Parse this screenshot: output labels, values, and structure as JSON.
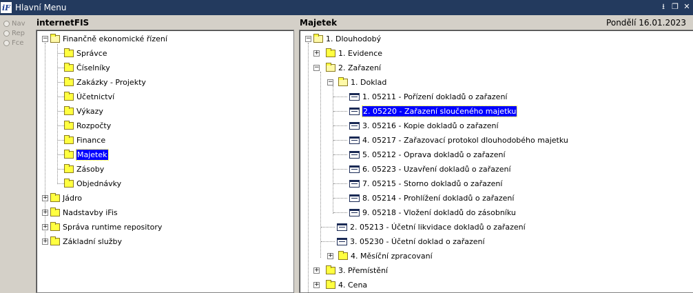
{
  "window": {
    "title": "Hlavní Menu"
  },
  "side_radios": [
    "Nav",
    "Rep",
    "Fce"
  ],
  "left_panel": {
    "header": "internetFIS",
    "root": "Finančně ekonomické řízení",
    "children": [
      "Správce",
      "Číselníky",
      "Zakázky - Projekty",
      "Účetnictví",
      "Výkazy",
      "Rozpočty",
      "Finance",
      "Majetek",
      "Zásoby",
      "Objednávky"
    ],
    "selected": "Majetek",
    "others": [
      "Jádro",
      "Nadstavby iFis",
      "Správa runtime repository",
      "Základní služby"
    ]
  },
  "right_panel": {
    "header": "Majetek",
    "date": "Pondělí 16.01.2023",
    "root": "1.  Dlouhodobý",
    "evidence": "1.  Evidence",
    "zarazeni": "2.  Zařazení",
    "doklad": "1.  Doklad",
    "doklad_items": [
      "1.  05211 - Pořízení dokladů o zařazení",
      "2.  05220 - Zařazení sloučeného majetku",
      "3.  05216 - Kopie dokladů o zařazení",
      "4.  05217 - Zařazovací protokol dlouhodobého majetku",
      "5.  05212 - Oprava dokladů o zařazení",
      "6.  05223 - Uzavření dokladů o zařazení",
      "7.  05215 - Storno dokladů o zařazení",
      "8.  05214 - Prohlížení dokladů o zařazení",
      "9.  05218 - Vložení dokladů do zásobníku"
    ],
    "zarazeni_items": [
      "2.  05213 - Účetní likvidace dokladů o zařazení",
      "3.  05230 - Účetní doklad o zařazení"
    ],
    "mesicni": "4.  Měsíční zpracovaní",
    "premisteni": "3.  Přemístění",
    "cena": "4.  Cena"
  }
}
